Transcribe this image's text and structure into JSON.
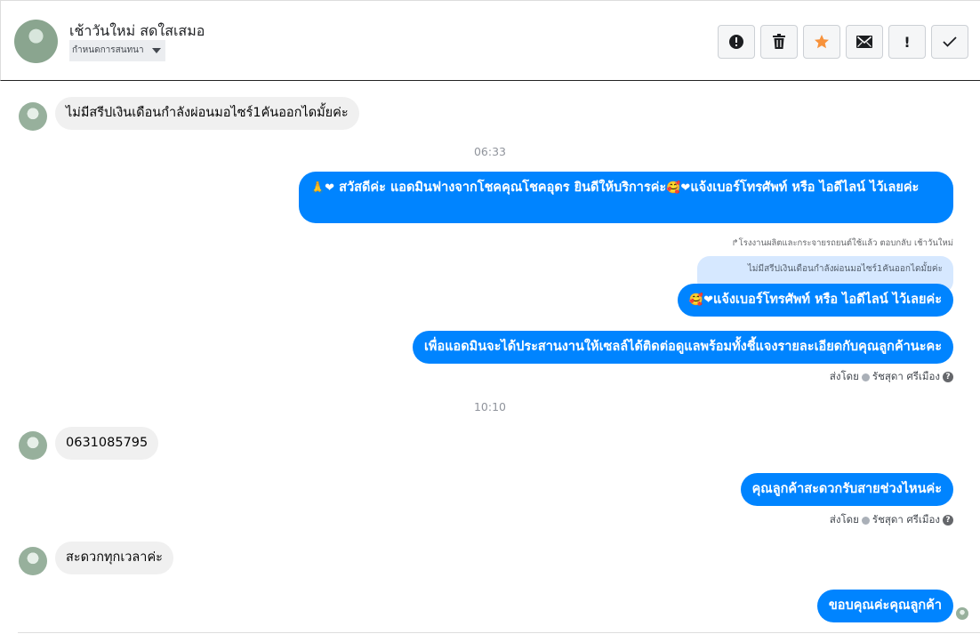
{
  "header": {
    "title": "เช้าวันใหม่ สดใสเสมอ",
    "assign_label": "กำหนดการสนทนา",
    "buttons": [
      {
        "icon": "alert-circle-icon"
      },
      {
        "icon": "trash-icon"
      },
      {
        "icon": "star-icon",
        "color": "#f7923b"
      },
      {
        "icon": "envelope-icon"
      },
      {
        "icon": "exclamation-icon",
        "label": "!"
      },
      {
        "icon": "check-icon"
      }
    ]
  },
  "messages": {
    "in1": "ไม่มีสรีปเงินเดือนกำลังผ่อนมอไซร์1คันออกไดมั้ยค่ะ",
    "time1": "06:33",
    "out1_emoji_prefix": "🙏❤",
    "out1": "สวัสดีค่ะ แอดมินฟางจากโชคคุณโชคอุดร ยินดีให้บริการค่ะ",
    "out1_emoji_mid": "🥰❤",
    "out1_rest": "แจ้งเบอร์โทรศัพท์ หรือ ไอดีไลน์  ไว้เลยค่ะ",
    "reply_note": "↱โรงงานผลิตและกระจายรถยนต์ใช้แล้ว ตอบกลับ เช้าวันใหม่",
    "quoted": "ไม่มีสรีปเงินเดือนกำลังผ่อนมอไซร์1คันออกไดมั้ยค่ะ",
    "out2_emoji": "🥰❤",
    "out2": "แจ้งเบอร์โทรศัพท์ หรือ ไอดีไลน์  ไว้เลยค่ะ",
    "out3": "เพื่อแอดมินจะได้ประสานงานให้เซลล์ได้ติดต่อดูแลพร้อมทั้งชี้แจงรายละเอียดกับคุณลูกค้านะคะ",
    "sentby1_prefix": "ส่งโดย",
    "sentby1_name": "รัชสุดา ศรีเมือง",
    "time2": "10:10",
    "in2": "0631085795",
    "out4": "คุณลูกค้าสะดวกรับสายช่วงไหนค่ะ",
    "sentby2_prefix": "ส่งโดย",
    "sentby2_name": "รัชสุดา ศรีเมือง",
    "in3": "สะดวกทุกเวลาค่ะ",
    "out5": "ขอบคุณค่ะคุณลูกค้า"
  },
  "colors": {
    "outgoing_bubble": "#0084ff",
    "incoming_bubble": "#f0f0f0",
    "quoted_bubble": "#d6e8ff"
  }
}
